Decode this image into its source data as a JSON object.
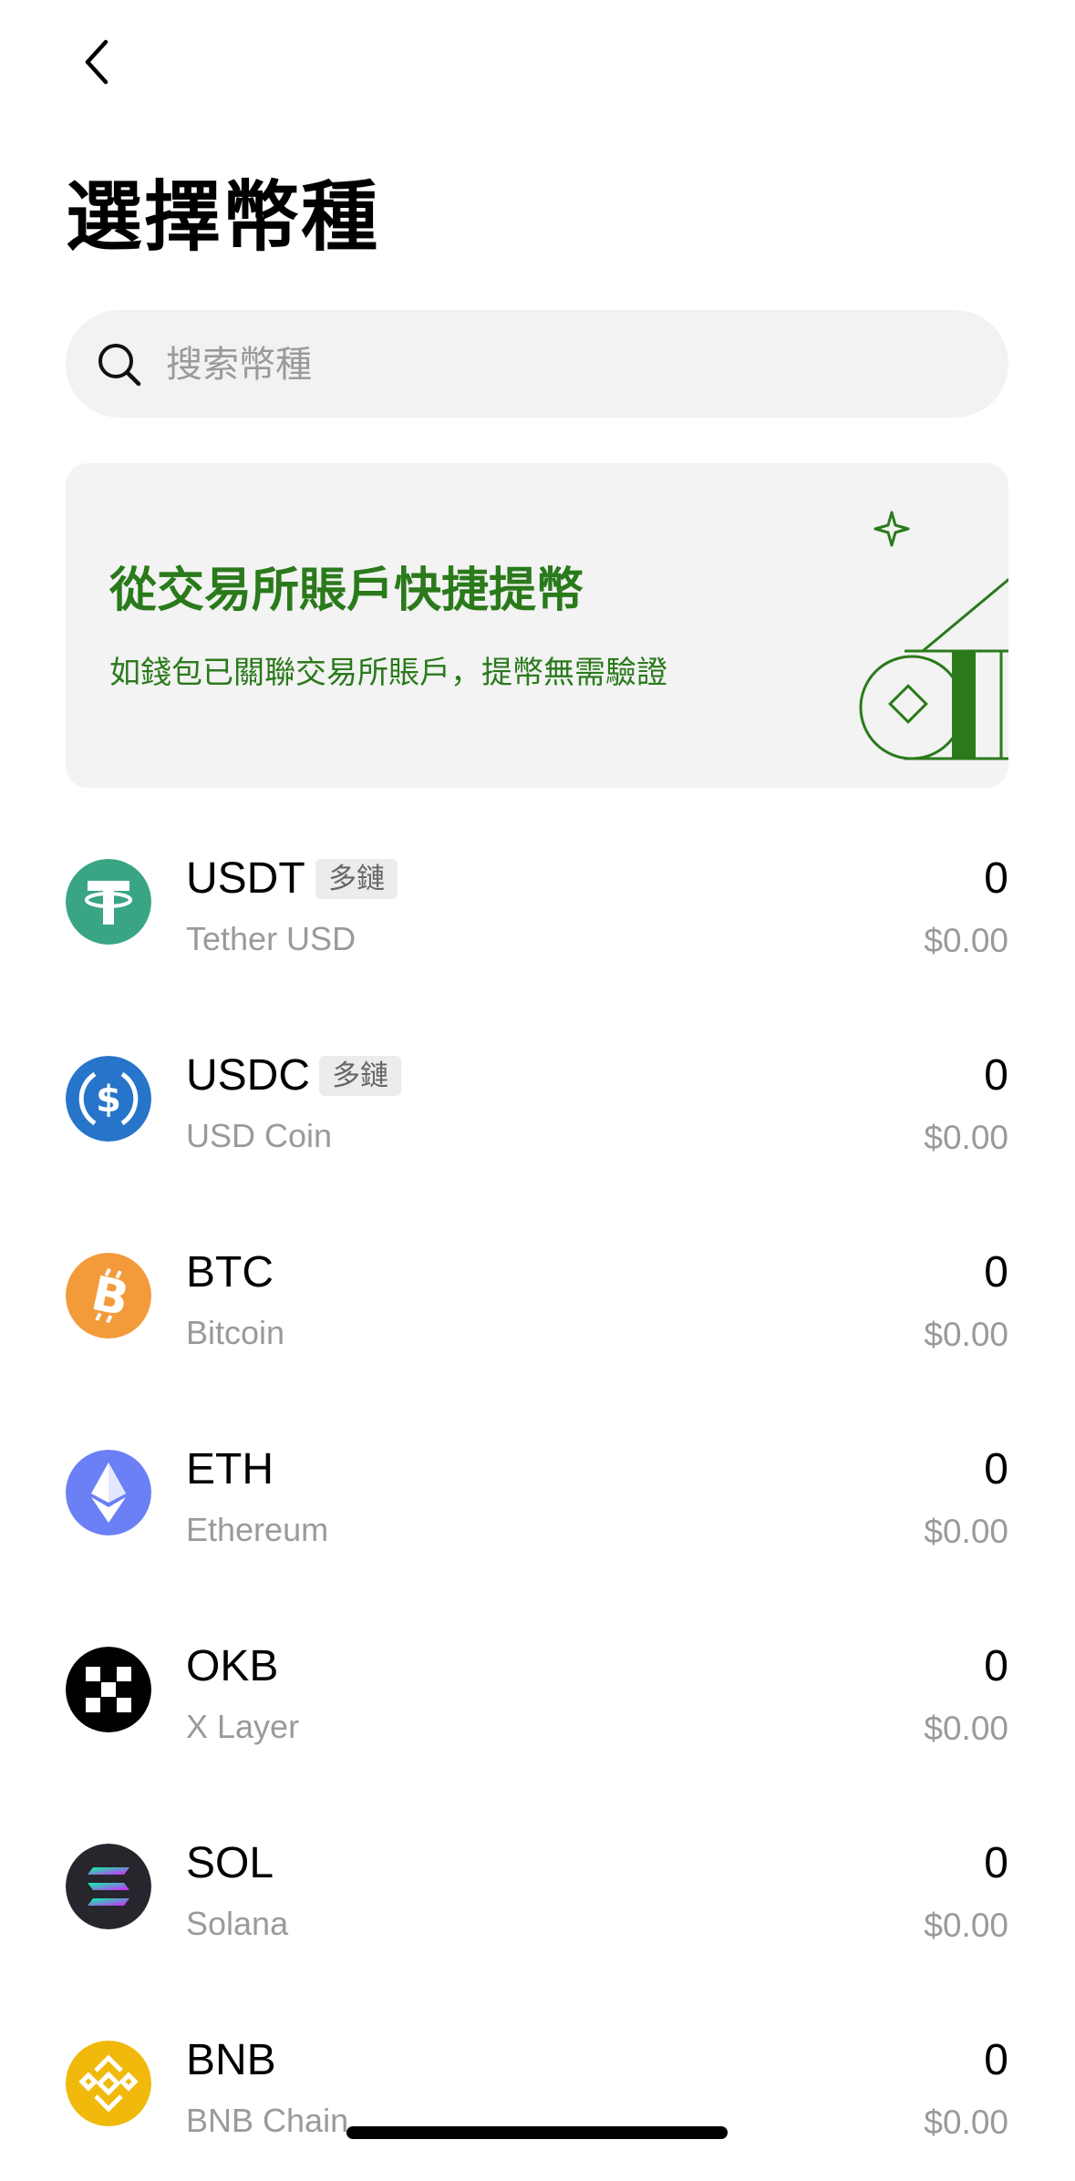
{
  "header": {
    "back_icon": "chevron-left-icon",
    "title": "選擇幣種"
  },
  "search": {
    "placeholder": "搜索幣種",
    "icon": "search-icon"
  },
  "promo": {
    "title": "從交易所賬戶快捷提幣",
    "subtitle": "如錢包已關聯交易所賬戶，提幣無需驗證",
    "accent_color": "#2a7a1b"
  },
  "coins": [
    {
      "symbol": "USDT",
      "badge": "多鏈",
      "name": "Tether USD",
      "amount": "0",
      "value": "$0.00",
      "icon": "tether-icon",
      "color": "#3aa585"
    },
    {
      "symbol": "USDC",
      "badge": "多鏈",
      "name": "USD Coin",
      "amount": "0",
      "value": "$0.00",
      "icon": "usdc-icon",
      "color": "#2775ca"
    },
    {
      "symbol": "BTC",
      "name": "Bitcoin",
      "amount": "0",
      "value": "$0.00",
      "icon": "bitcoin-icon",
      "color": "#f39a3a"
    },
    {
      "symbol": "ETH",
      "name": "Ethereum",
      "amount": "0",
      "value": "$0.00",
      "icon": "ethereum-icon",
      "color": "#6b80f5"
    },
    {
      "symbol": "OKB",
      "name": "X Layer",
      "amount": "0",
      "value": "$0.00",
      "icon": "okb-icon",
      "color": "#000000"
    },
    {
      "symbol": "SOL",
      "name": "Solana",
      "amount": "0",
      "value": "$0.00",
      "icon": "solana-icon",
      "color": "#26262c"
    },
    {
      "symbol": "BNB",
      "name": "BNB Chain",
      "amount": "0",
      "value": "$0.00",
      "icon": "bnb-icon",
      "color": "#f0b90b"
    }
  ]
}
